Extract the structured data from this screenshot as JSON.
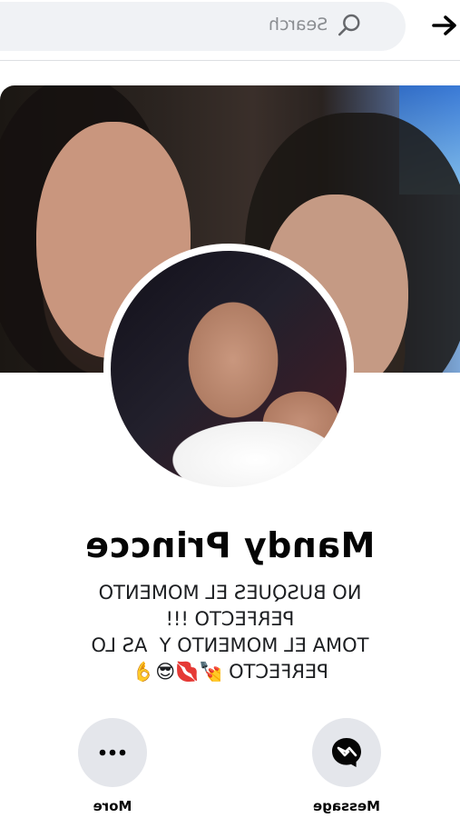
{
  "topbar": {
    "search_placeholder": "Search",
    "back_icon": "arrow-right-icon"
  },
  "profile": {
    "name": "Mandy Princce",
    "bio_lines": [
      "NO BUSQUES EL MOMENTO",
      "PERFECTO !!!",
      "TOMA EL MOMENTO Y  AS LO",
      "PERFECTO 💅💋😎👌"
    ]
  },
  "actions": {
    "more": "More",
    "message": "Message"
  },
  "colors": {
    "search_bg": "#f0f2f5",
    "button_bg": "#e4e6eb"
  }
}
